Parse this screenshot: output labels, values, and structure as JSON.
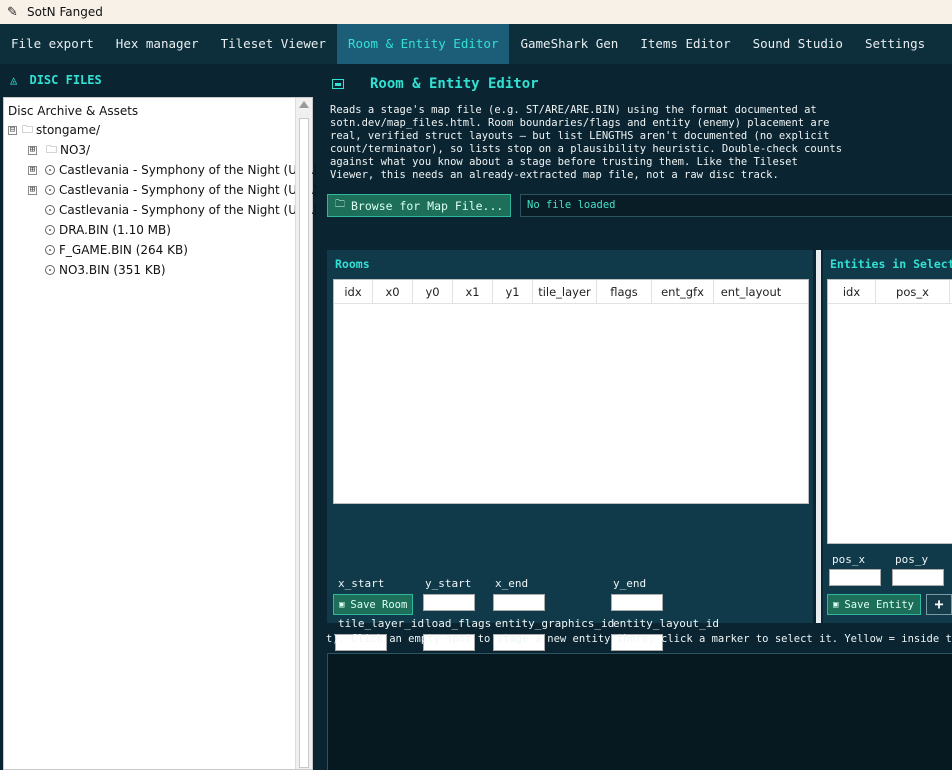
{
  "window": {
    "title": "SotN Fanged",
    "icon": "feather-icon"
  },
  "tabs": [
    {
      "label": "File export",
      "active": false
    },
    {
      "label": "Hex manager",
      "active": false
    },
    {
      "label": "Tileset Viewer",
      "active": false
    },
    {
      "label": "Room & Entity Editor",
      "active": true
    },
    {
      "label": "GameShark Gen",
      "active": false
    },
    {
      "label": "Items Editor",
      "active": false
    },
    {
      "label": "Sound Studio",
      "active": false
    },
    {
      "label": "Settings",
      "active": false
    }
  ],
  "sidebar": {
    "header": "DISC FILES",
    "header_icon": "disc-icon",
    "tree_caption": "Disc Archive & Assets",
    "nodes": [
      {
        "label": "stongame/",
        "expander": "⊟",
        "icon": "folder-icon"
      },
      {
        "label": "NO3/",
        "expander": "⊞",
        "icon": "folder-icon"
      },
      {
        "label": "Castlevania - Symphony of the Night (USA) (",
        "expander": "⊞",
        "icon": "disc-icon"
      },
      {
        "label": "Castlevania - Symphony of the Night (USA) (",
        "expander": "⊞",
        "icon": "disc-icon"
      },
      {
        "label": "Castlevania - Symphony of the Night (USA).c",
        "expander": "",
        "icon": "disc-icon"
      },
      {
        "label": "DRA.BIN (1.10 MB)",
        "expander": "",
        "icon": "disc-icon"
      },
      {
        "label": "F_GAME.BIN (264 KB)",
        "expander": "",
        "icon": "disc-icon"
      },
      {
        "label": "NO3.BIN (351 KB)",
        "expander": "",
        "icon": "disc-icon"
      }
    ]
  },
  "editor": {
    "title": "Room & Entity Editor",
    "description": "Reads a stage's map file (e.g. ST/ARE/ARE.BIN) using the format documented at\nsotn.dev/map_files.html. Room boundaries/flags and entity (enemy) placement are\nreal, verified struct layouts — but list LENGTHS aren't documented (no explicit\ncount/terminator), so lists stop on a plausibility heuristic. Double-check counts\nagainst what you know about a stage before trusting them. Like the Tileset\nViewer, this needs an already-extracted map file, not a raw disc track.",
    "browse_label": "Browse for Map File...",
    "file_status": "No file loaded"
  },
  "rooms": {
    "title": "Rooms",
    "columns": [
      "idx",
      "x0",
      "y0",
      "x1",
      "y1",
      "tile_layer",
      "flags",
      "ent_gfx",
      "ent_layout"
    ],
    "fields": {
      "x_start": "x_start",
      "y_start": "y_start",
      "x_end": "x_end",
      "y_end": "y_end",
      "tile_layer_id": "tile_layer_id",
      "load_flags": "load_flags",
      "entity_graphics_id": "entity_graphics_id",
      "entity_layout_id": "entity_layout_id"
    },
    "save_label": "Save Room"
  },
  "entities": {
    "title": "Entities in Select",
    "columns": [
      "idx",
      "pos_x"
    ],
    "fields": {
      "pos_x": "pos_x",
      "pos_y": "pos_y"
    },
    "save_label": "Save Entity",
    "add_label": "+"
  },
  "canvas_hint": "t). Click an empty spot to stage a new entity there, click a marker to select it. Yellow = inside the ro"
}
